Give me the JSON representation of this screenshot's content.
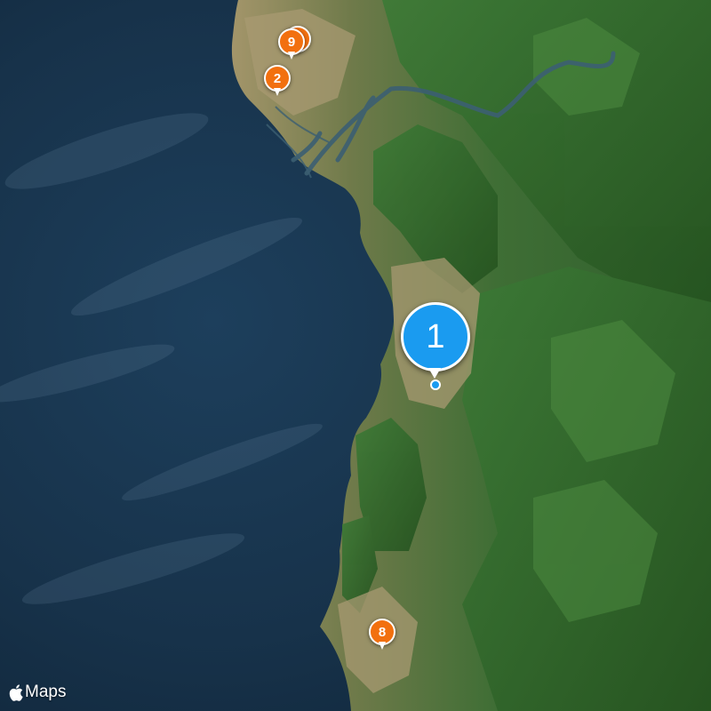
{
  "map": {
    "style": "satellite",
    "attribution": "Maps",
    "attribution_logo": "apple-logo-icon"
  },
  "markers": [
    {
      "id": "1",
      "label": "1",
      "kind": "selected",
      "color": "#1a9bf0"
    },
    {
      "id": "2",
      "label": "2",
      "kind": "cluster",
      "color": "#f2700f"
    },
    {
      "id": "8",
      "label": "8",
      "kind": "cluster",
      "color": "#f2700f"
    },
    {
      "id": "9",
      "label": "9",
      "kind": "cluster",
      "color": "#f2700f"
    }
  ],
  "colors": {
    "ocean": "#17324a",
    "forest": "#3a6d32",
    "lowland": "#9a8f66"
  }
}
